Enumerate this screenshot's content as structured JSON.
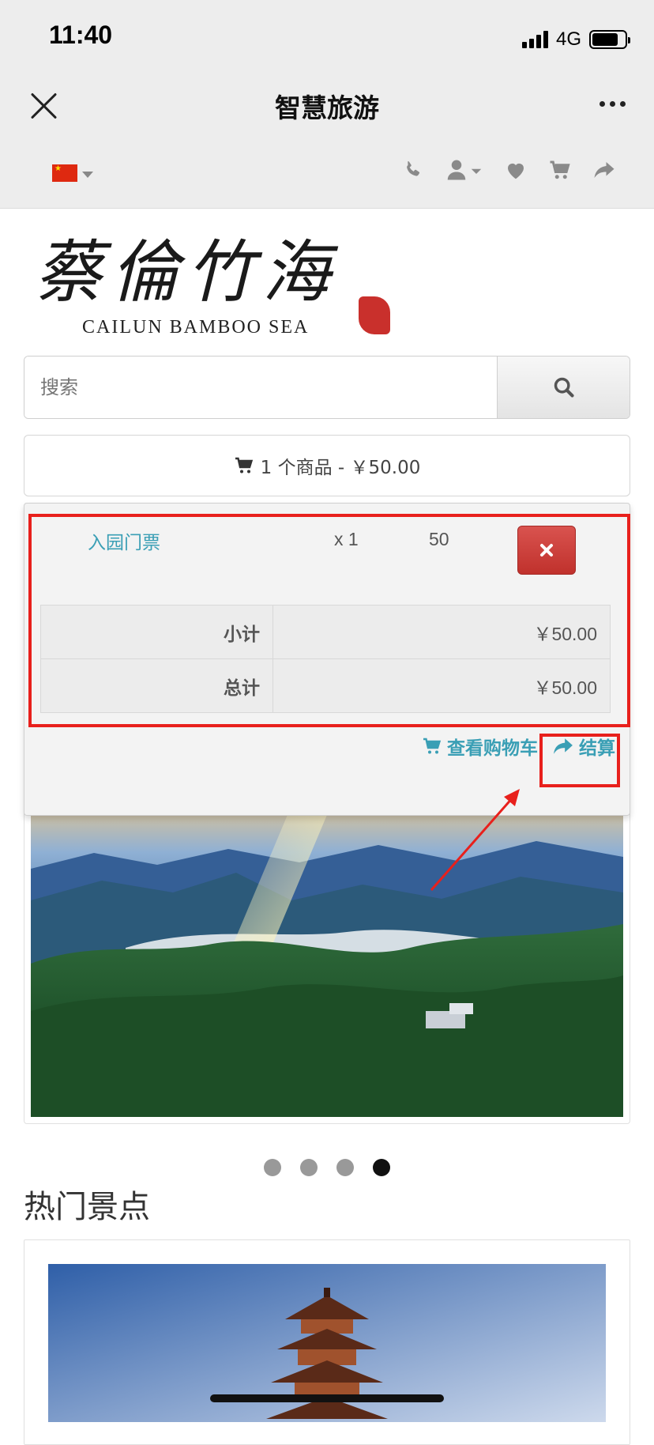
{
  "status_bar": {
    "time": "11:40",
    "network": "4G"
  },
  "nav": {
    "title": "智慧旅游"
  },
  "header_icons": [
    "phone-icon",
    "user-icon",
    "heart-icon",
    "cart-icon",
    "share-icon"
  ],
  "logo": {
    "cn": "蔡倫竹海",
    "en": "CAILUN BAMBOO SEA"
  },
  "search": {
    "placeholder": "搜索"
  },
  "cart_button": {
    "label": "1 个商品 - ￥50.00"
  },
  "cart_dropdown": {
    "item": {
      "name": "入园门票",
      "qty": "x 1",
      "price": "50"
    },
    "subtotal": {
      "label": "小计",
      "value": "￥50.00"
    },
    "total": {
      "label": "总计",
      "value": "￥50.00"
    },
    "view_cart_label": "查看购物车",
    "checkout_label": "结算"
  },
  "carousel": {
    "slides": 4,
    "active_index": 3
  },
  "section": {
    "title": "热门景点"
  },
  "colors": {
    "link": "#3a9fb5",
    "danger": "#d9534f",
    "annotation": "#e8201c"
  }
}
